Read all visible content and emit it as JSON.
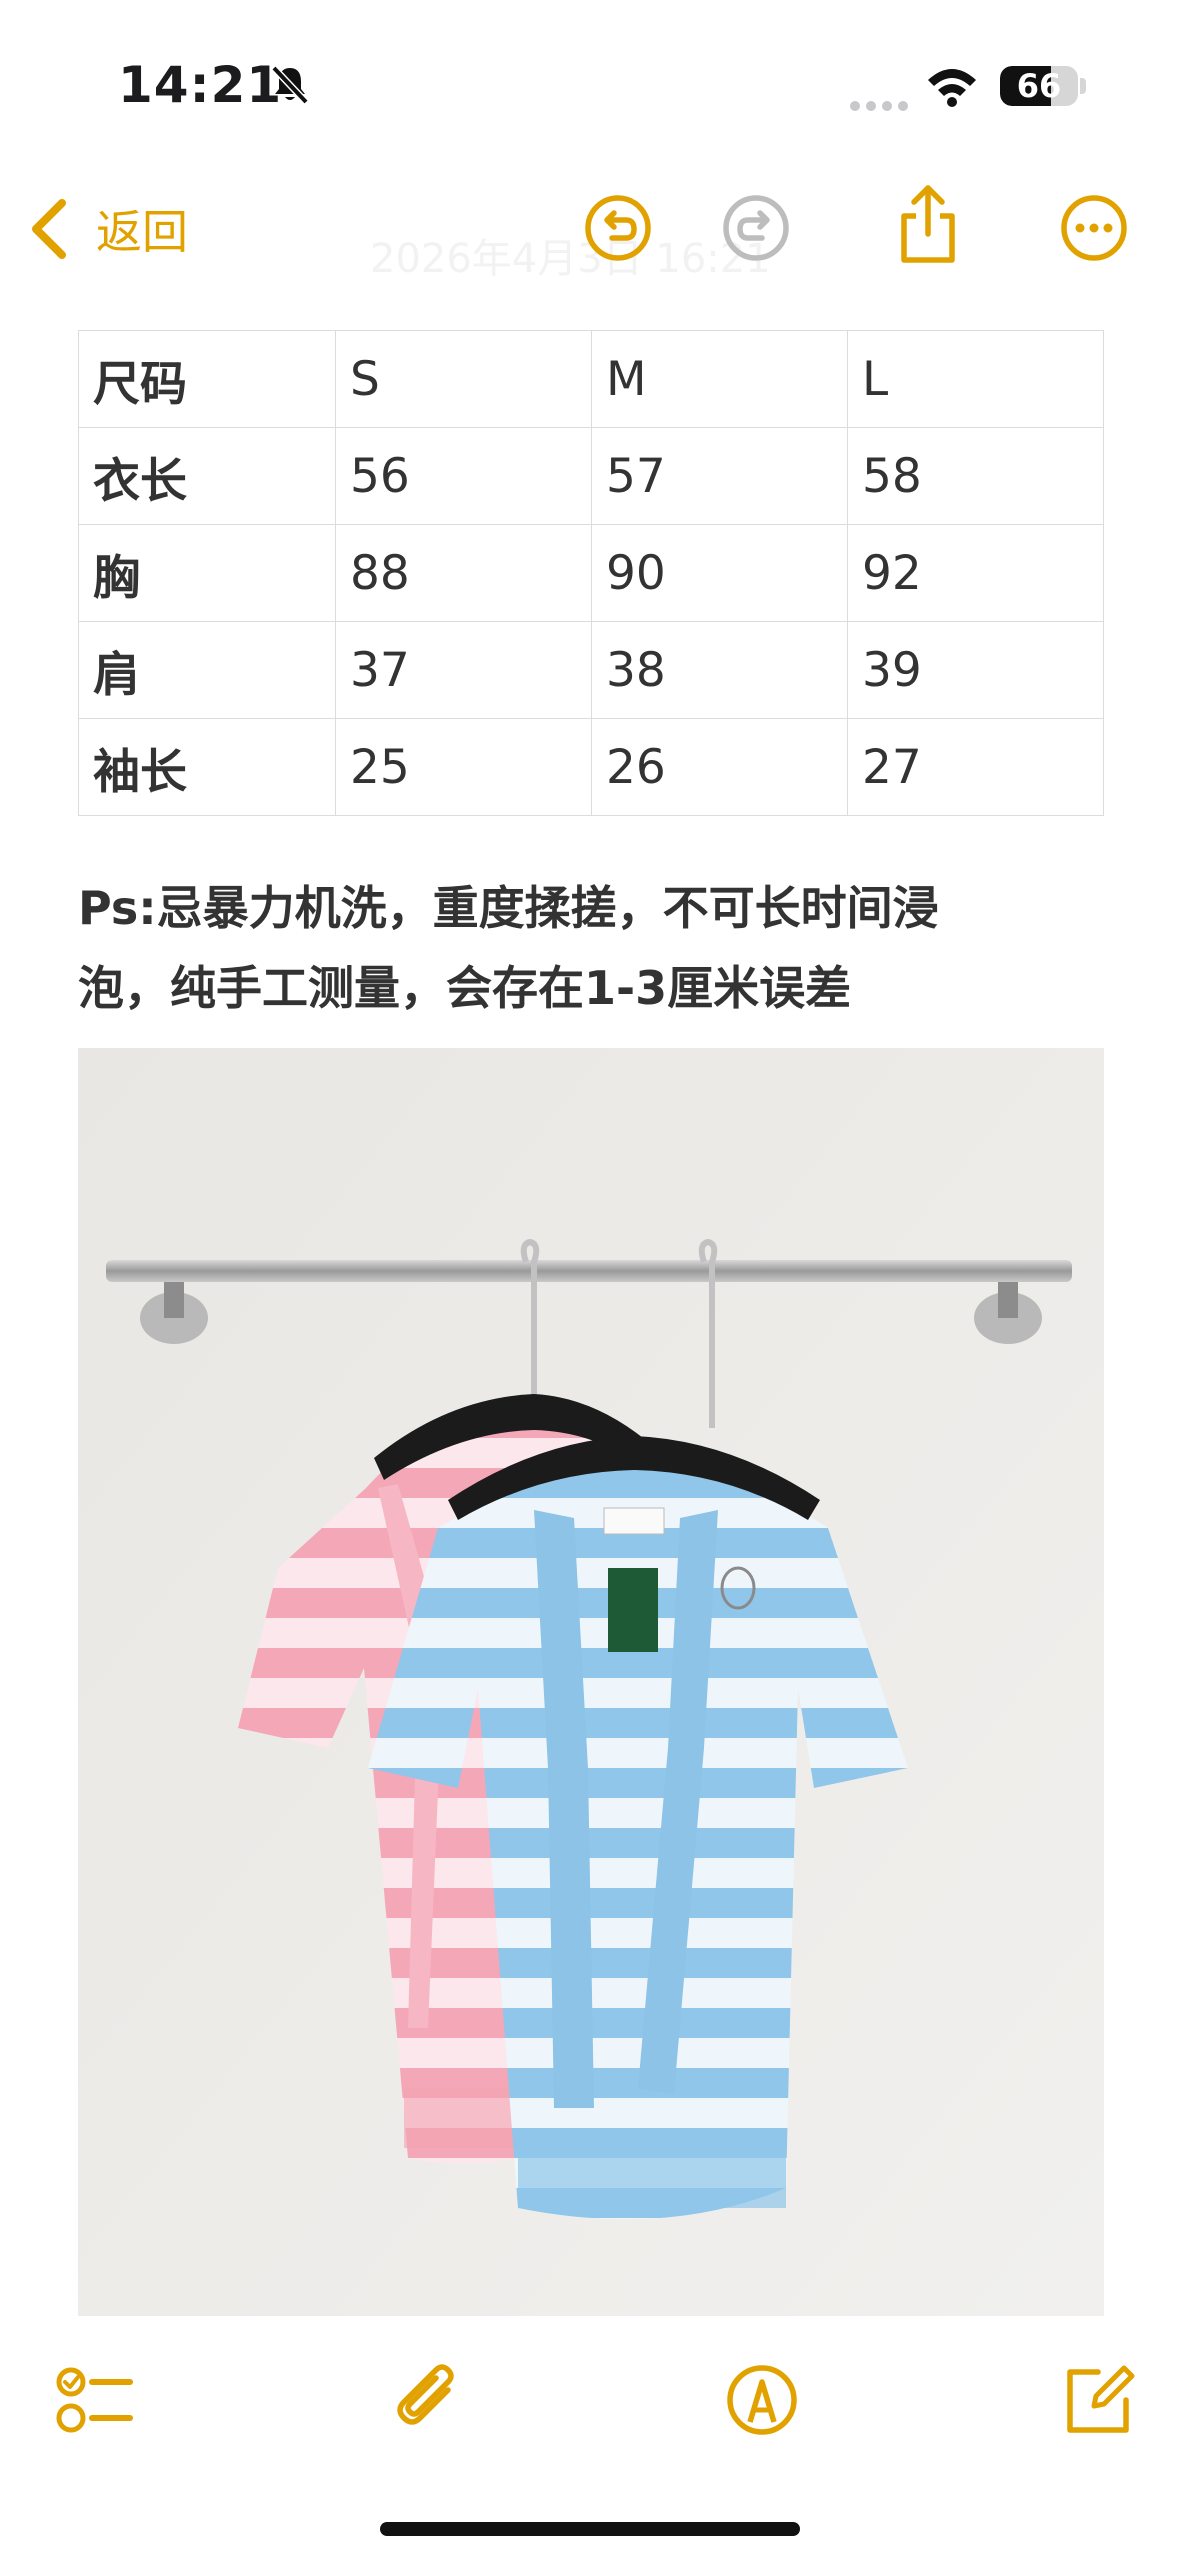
{
  "status_bar": {
    "time": "14:21",
    "battery_text": "66",
    "battery_level": 0.66
  },
  "nav": {
    "back_label": "返回",
    "faded_date": "2026年4月3日 16:21"
  },
  "size_table": {
    "rows": [
      [
        "尺码",
        "S",
        "M",
        "L"
      ],
      [
        "衣长",
        "56",
        "57",
        "58"
      ],
      [
        "胸",
        "88",
        "90",
        "92"
      ],
      [
        "肩",
        "37",
        "38",
        "39"
      ],
      [
        "袖长",
        "25",
        "26",
        "27"
      ]
    ]
  },
  "note": {
    "line1": "Ps:忌暴力机洗，重度揉搓，不可长时间浸",
    "line2": "泡，纯手工测量，会存在1-3厘米误差"
  },
  "icons": {
    "accent": "#e1a200",
    "disabled": "#bdbdbd",
    "names": [
      "chevron-left-icon",
      "undo-icon",
      "redo-icon",
      "share-icon",
      "more-icon",
      "checklist-icon",
      "attachment-icon",
      "markup-icon",
      "compose-icon",
      "bell-slash-icon",
      "wifi-icon"
    ]
  }
}
